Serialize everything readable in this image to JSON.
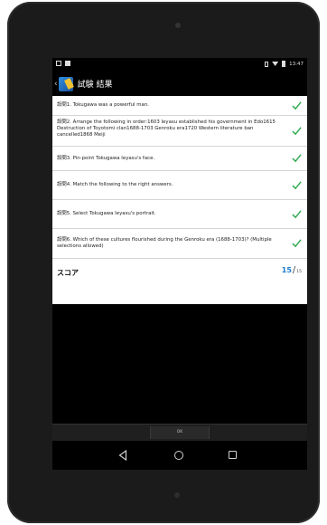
{
  "status_bar": {
    "time": "13:47"
  },
  "action_bar": {
    "title": "試験 結果"
  },
  "results": [
    {
      "text": "設問1. Tokugawa  was a powerful man.",
      "correct": true
    },
    {
      "text": "設問2. Arrange the following in order:1603           Ieyasu established his government in Edo1615           Destruction of Toyotomi clan1688-1703           Genroku era1720           Western literature ban cancelled1868           Meiji",
      "correct": true
    },
    {
      "text": "設問3. Pin-point Tokugawa Ieyasu's face.",
      "correct": true
    },
    {
      "text": "設問4. Match the following to the right answers.",
      "correct": true
    },
    {
      "text": "設問5. Select Tokugawa Ieyasu's portrait.",
      "correct": true
    },
    {
      "text": "設問6. Which of these cultures flourished during the Genroku era (1688-1703)? (Multiple selections allowed)",
      "correct": true
    }
  ],
  "score": {
    "label": "スコア",
    "value": "15",
    "slash": "/",
    "total": "15"
  },
  "ok_button": {
    "label": "OK"
  },
  "colors": {
    "check": "#2aa84a",
    "score": "#1a7ad0"
  }
}
